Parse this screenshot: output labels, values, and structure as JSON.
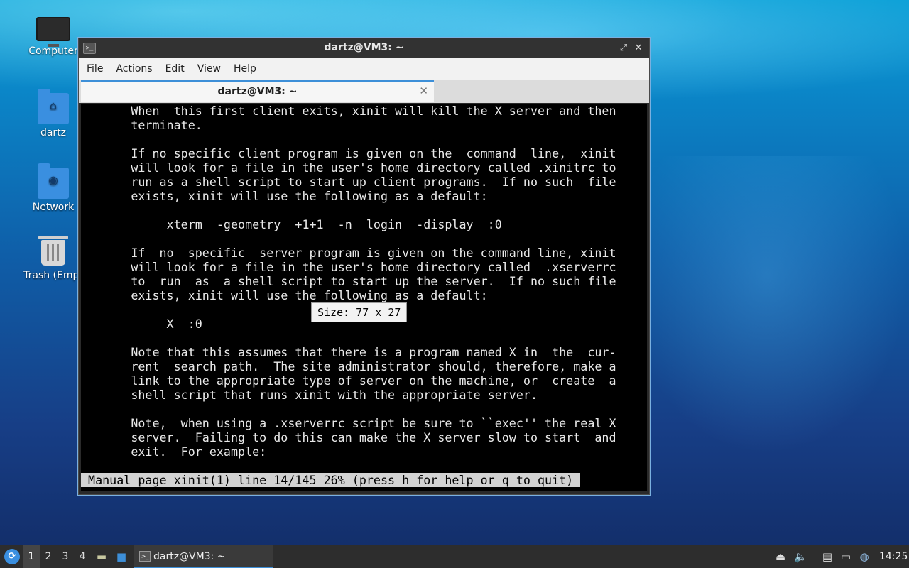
{
  "desktop": {
    "icons": [
      {
        "label": "Computer"
      },
      {
        "label": "dartz"
      },
      {
        "label": "Network"
      },
      {
        "label": "Trash (Empt"
      }
    ]
  },
  "window": {
    "title": "dartz@VM3: ~",
    "controls": {
      "minimize": "–",
      "maximize": "⤢",
      "close": "✕"
    },
    "menu": [
      "File",
      "Actions",
      "Edit",
      "View",
      "Help"
    ],
    "tab": {
      "label": "dartz@VM3: ~",
      "close": "✕"
    }
  },
  "terminal": {
    "lines": [
      "       When  this first client exits, xinit will kill the X server and then",
      "       terminate.",
      "",
      "       If no specific client program is given on the  command  line,  xinit",
      "       will look for a file in the user's home directory called .xinitrc to",
      "       run as a shell script to start up client programs.  If no such  file",
      "       exists, xinit will use the following as a default:",
      "",
      "            xterm  -geometry  +1+1  -n  login  -display  :0",
      "",
      "       If  no  specific  server program is given on the command line, xinit",
      "       will look for a file in the user's home directory called  .xserverrc",
      "       to  run  as  a shell script to start up the server.  If no such file",
      "       exists, xinit will use the following as a default:",
      "",
      "            X  :0",
      "",
      "       Note that this assumes that there is a program named X in  the  cur-",
      "       rent  search path.  The site administrator should, therefore, make a",
      "       link to the appropriate type of server on the machine, or  create  a",
      "       shell script that runs xinit with the appropriate server.",
      "",
      "       Note,  when using a .xserverrc script be sure to ``exec'' the real X",
      "       server.  Failing to do this can make the X server slow to start  and",
      "       exit.  For example:"
    ],
    "status": " Manual page xinit(1) line 14/145 26% (press h for help or q to quit)",
    "size_popup": "Size: 77 x 27"
  },
  "taskbar": {
    "start_icon": "whisker-menu-icon",
    "workspaces": [
      "1",
      "2",
      "3",
      "4"
    ],
    "active_workspace": "1",
    "task_label": "dartz@VM3: ~",
    "clock": "14:25"
  }
}
